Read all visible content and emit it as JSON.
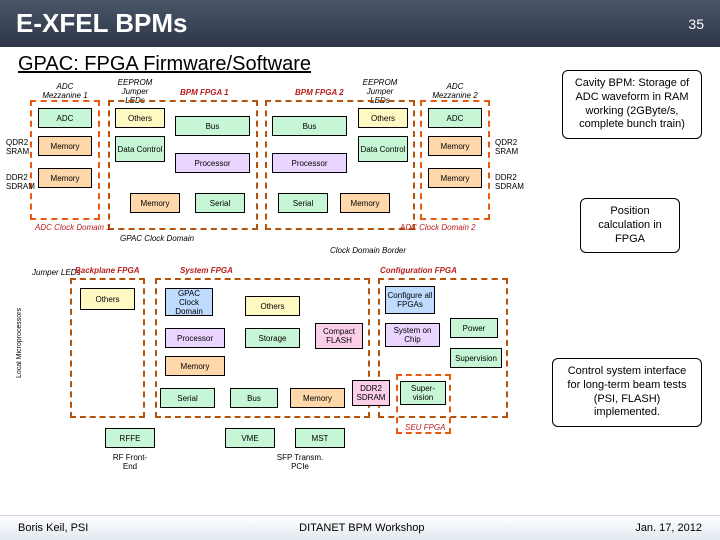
{
  "header": {
    "title": "E-XFEL BPMs",
    "page": "35"
  },
  "subtitle": "GPAC: FPGA Firmware/Software",
  "callouts": {
    "c1": "Cavity BPM: Storage of ADC waveform in RAM working (2GByte/s, complete bunch train)",
    "c2": "Position calculation in FPGA",
    "c3": "Control system interface for long-term beam tests (PSI, FLASH) implemented."
  },
  "labels": {
    "adc_mez1": "ADC\nMezzanine 1",
    "eeprom_jd": "EEPROM\nJumper\nLEDs",
    "bpm_fpga1": "BPM FPGA 1",
    "bpm_fpga2": "BPM FPGA 2",
    "adc_mez2": "ADC\nMezzanine 2",
    "backplane": "Backplane FPGA",
    "system_fpga": "System FPGA",
    "config_fpga": "Configuration FPGA",
    "gpac_clock": "GPAC Clock Domain",
    "adc_clock1": "ADC Clock Domain 1",
    "adc_clock2": "ADC Clock Domain 2",
    "clock_border": "Clock Domain Border",
    "jumper_leds": "Jumper\nLEDs",
    "seu_fpga": "SEU FPGA",
    "local_uproc": "Local Microprocessors",
    "rf_frontend": "RF\nFront-End",
    "sfp_pcie": "SFP\nTransm.\nPCIe"
  },
  "blocks": {
    "adc": "ADC",
    "memory": "Memory",
    "others": "Others",
    "data_control": "Data\nControl",
    "bus": "Bus",
    "processor": "Processor",
    "serial": "Serial",
    "storage": "Storage",
    "rffe": "RFFE",
    "vme": "VME",
    "mst": "MST",
    "compact_flash": "Compact\nFLASH",
    "ddr2_sdram": "DDR2\nSDRAM",
    "soc": "System on\nChip",
    "power": "Power",
    "supervision": "Supervision",
    "configure_all": "Configure\nall\nFPGAs",
    "super_vision": "Super-\nvision",
    "gpac_clock_domain": "GPAC\nClock\nDomain"
  },
  "side": {
    "qdr2": "QDR2\nSRAM",
    "ddr2": "DDR2\nSDRAM"
  },
  "footer": {
    "left": "Boris Keil, PSI",
    "center": "DITANET BPM Workshop",
    "right": "Jan. 17, 2012"
  }
}
